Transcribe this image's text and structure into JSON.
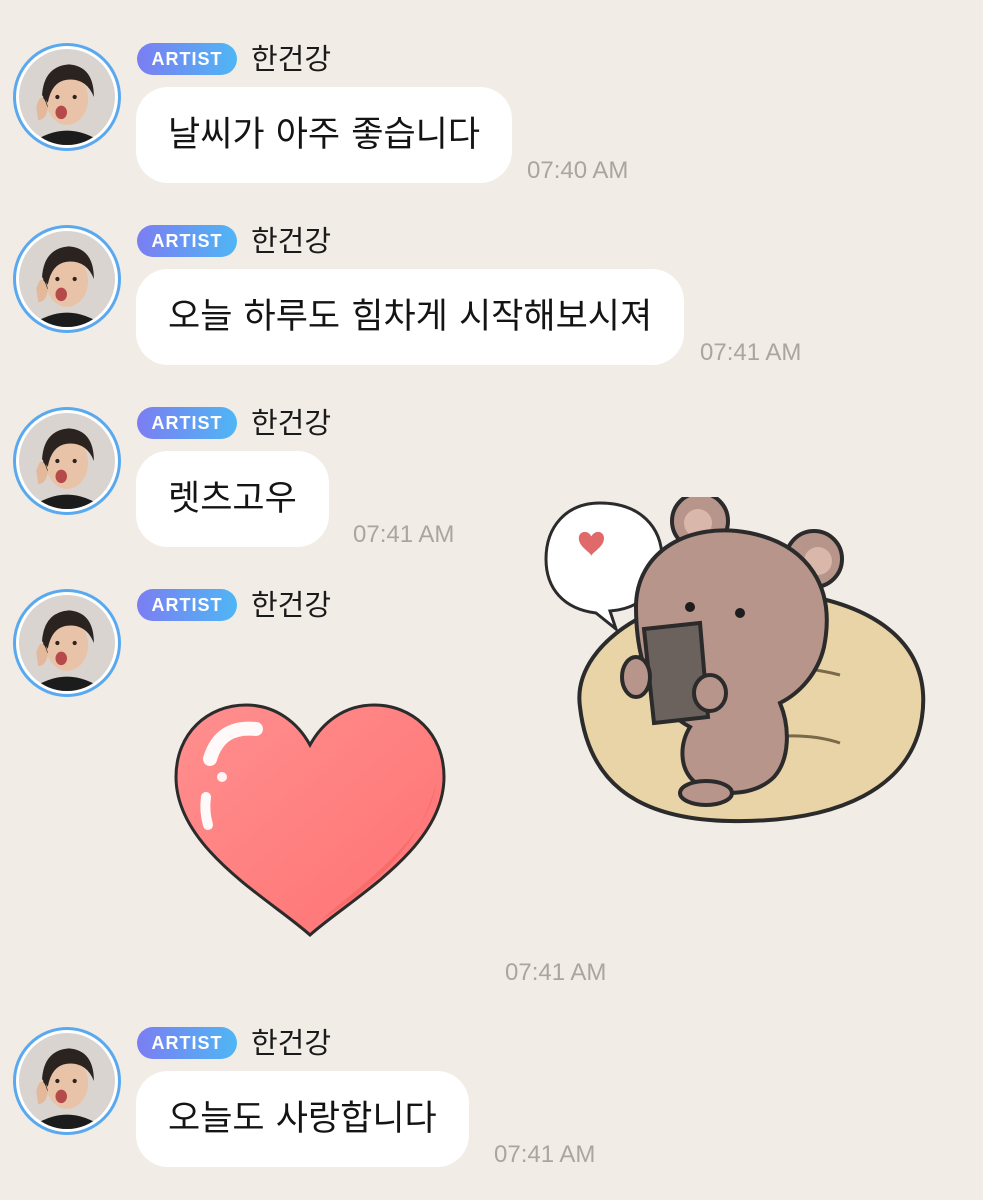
{
  "artist_badge": "ARTIST",
  "sender_name": "한건강",
  "messages": [
    {
      "text": "날씨가 아주 좋습니다",
      "time": "07:40 AM"
    },
    {
      "text": "오늘 하루도 힘차게 시작해보시져",
      "time": "07:41 AM"
    },
    {
      "text": "렛츠고우",
      "time": "07:41 AM"
    },
    {
      "sticker": "heart-sticker, bear-with-phone-sticker",
      "time": "07:41 AM"
    },
    {
      "text": "오늘도 사랑합니다",
      "time": "07:41 AM"
    }
  ],
  "colors": {
    "background": "#f1ece6",
    "bubble": "#ffffff",
    "badge_gradient_start": "#7b7ef2",
    "badge_gradient_end": "#4fb6f4",
    "avatar_ring": "#5aa9ef",
    "timestamp": "#a9a5a0"
  }
}
